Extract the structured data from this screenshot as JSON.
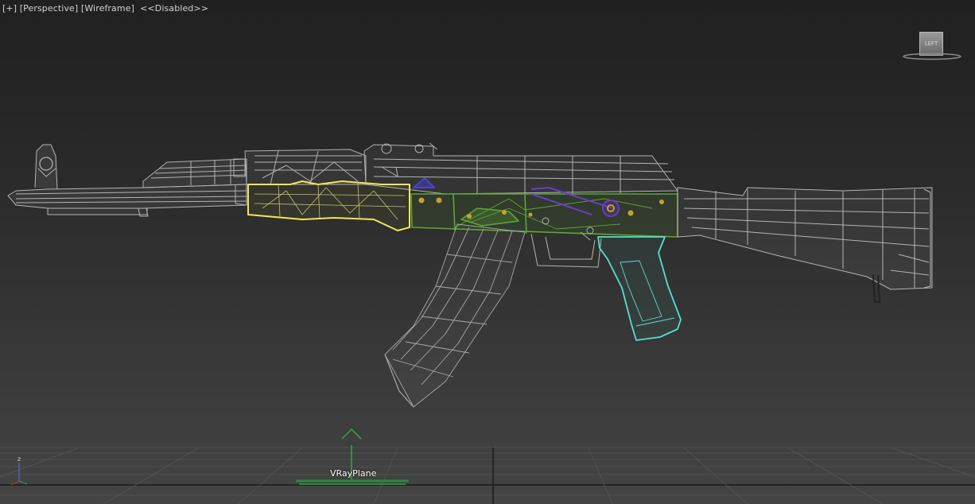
{
  "viewport": {
    "menu": {
      "plus": "[+]",
      "view": "[Perspective]",
      "shading": "[Wireframe]",
      "state": "<<Disabled>>"
    },
    "viewcube_label": "LEFT",
    "object_label": "VRayPlane",
    "axis_label": "z"
  },
  "colors": {
    "background": "#2b2b2b",
    "wire_default": "#b8b8b8",
    "selected_yellow": "#f1e65a",
    "receiver_green": "#5aa832",
    "grip_cyan": "#55e0cc",
    "lever_purple": "#6b3bd1",
    "grid_line": "#5a5a5a",
    "gizmo_green": "#2fa84a"
  }
}
